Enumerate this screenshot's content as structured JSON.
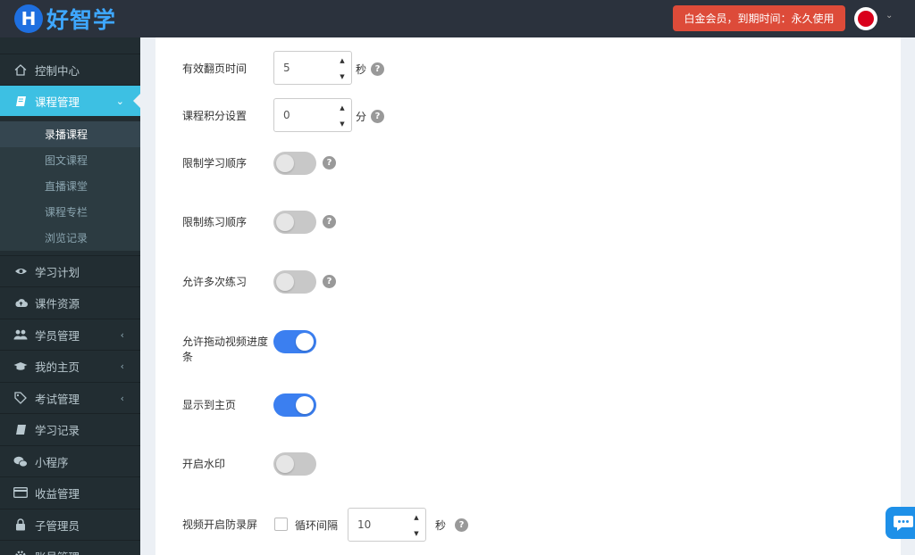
{
  "header": {
    "logo_letter": "H",
    "logo_text": "好智学",
    "vip_text": "白金会员，到期时间：永久使用",
    "colors": {
      "bar": "#2b323d",
      "vip": "#dd4b39",
      "logo": "#3ea7ff"
    }
  },
  "sidebar": {
    "items": [
      {
        "label": "控制中心",
        "icon": "home-icon"
      },
      {
        "label": "课程管理",
        "icon": "book-icon",
        "active": true
      },
      {
        "label": "学习计划",
        "icon": "eye-icon"
      },
      {
        "label": "课件资源",
        "icon": "cloud-upload-icon"
      },
      {
        "label": "学员管理",
        "icon": "users-icon"
      },
      {
        "label": "我的主页",
        "icon": "graduation-cap-icon"
      },
      {
        "label": "考试管理",
        "icon": "tag-icon"
      },
      {
        "label": "学习记录",
        "icon": "book-icon"
      },
      {
        "label": "小程序",
        "icon": "wechat-icon"
      },
      {
        "label": "收益管理",
        "icon": "credit-card-icon"
      },
      {
        "label": "子管理员",
        "icon": "lock-icon"
      },
      {
        "label": "账号管理",
        "icon": "settings-icon"
      }
    ],
    "sub_items": [
      {
        "label": "录播课程",
        "current": true
      },
      {
        "label": "图文课程"
      },
      {
        "label": "直播课堂"
      },
      {
        "label": "课程专栏"
      },
      {
        "label": "浏览记录"
      }
    ]
  },
  "form": {
    "page_time": {
      "label": "有效翻页时间",
      "value": "5",
      "unit": "秒"
    },
    "points": {
      "label": "课程积分设置",
      "value": "0",
      "unit": "分"
    },
    "toggles": [
      {
        "label": "限制学习顺序",
        "on": false,
        "help": true
      },
      {
        "label": "限制练习顺序",
        "on": false,
        "help": true
      },
      {
        "label": "允许多次练习",
        "on": false,
        "help": true
      },
      {
        "label": "允许拖动视频进度条",
        "on": true,
        "help": false
      },
      {
        "label": "显示到主页",
        "on": true,
        "help": false
      },
      {
        "label": "开启水印",
        "on": false,
        "help": false
      }
    ],
    "anti_record": {
      "label": "视频开启防录屏",
      "checkbox_label": "循环间隔",
      "value": "10",
      "unit": "秒"
    },
    "help_glyph": "?",
    "spin_up": "▲",
    "spin_down": "▼"
  }
}
